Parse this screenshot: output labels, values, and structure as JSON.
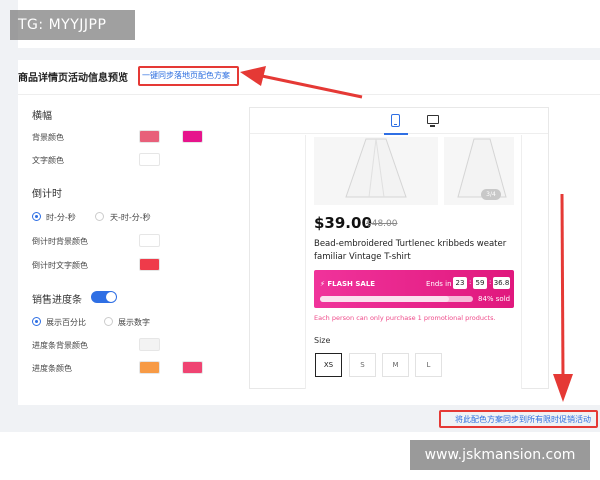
{
  "watermarks": {
    "top_left": "TG: MYYJJPP",
    "bottom_right": "www.jskmansion.com"
  },
  "section": {
    "title": "商品详情页活动信息预览",
    "sync_link": "一键同步落地页配色方案"
  },
  "banner": {
    "title": "横幅",
    "bg_color_label": "背景颜色",
    "bg_colors": [
      "#e8607a",
      "#e6148c"
    ],
    "text_color_label": "文字颜色",
    "text_color": "#ffffff"
  },
  "countdown": {
    "title": "倒计时",
    "options": [
      "时-分-秒",
      "天-时-分-秒"
    ],
    "selected": "时-分-秒",
    "bg_label": "倒计时背景颜色",
    "bg_color": "#ffffff",
    "text_label": "倒计时文字颜色",
    "text_color": "#ef3b4a"
  },
  "progress": {
    "title": "销售进度条",
    "enabled": true,
    "options": [
      "展示百分比",
      "展示数字"
    ],
    "selected": "展示百分比",
    "bg_label": "进度条背景颜色",
    "bg_color": "#f3f3f3",
    "color_label": "进度条颜色",
    "colors": [
      "#f79a45",
      "#ef4472"
    ]
  },
  "preview": {
    "device_icons": [
      "phone-icon",
      "desktop-icon"
    ],
    "active_device": "phone-icon",
    "image_badge": "3/4",
    "price": "$39.00",
    "old_price": "$48.00",
    "product_title": "Bead-embroidered Turtlenec kribbeds weater familiar Vintage T-shirt",
    "flash_label": "FLASH SALE",
    "ends_label": "Ends in",
    "timer": [
      "23",
      "59",
      "36.8"
    ],
    "sold_fraction": 0.84,
    "sold_text": "84% sold",
    "limit_note": "Each person can only purchase 1 promotional products.",
    "size_label": "Size",
    "sizes": [
      "XS",
      "S",
      "M",
      "L"
    ],
    "selected_size": "XS"
  },
  "footer": {
    "apply_all_link": "将此配色方案同步到所有限时促销活动"
  },
  "colors": {
    "accent": "#2f6fe4",
    "annotation": "#e53935",
    "flash_gradient": [
      "#f0339b",
      "#e0187d"
    ]
  }
}
